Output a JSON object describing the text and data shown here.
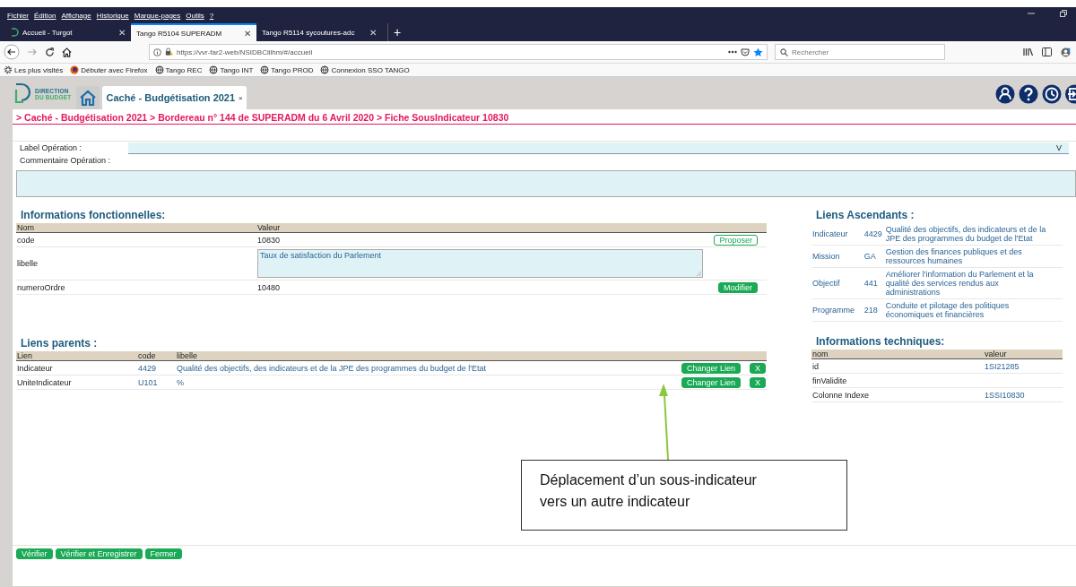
{
  "browser": {
    "menu": [
      "Fichier",
      "Édition",
      "Affichage",
      "Historique",
      "Marque-pages",
      "Outils",
      "?"
    ],
    "tabs": [
      {
        "label": "Accueil - Turgot",
        "selected": false,
        "close": "✕"
      },
      {
        "label": "Tango R5104 SUPERADM",
        "selected": true,
        "close": "✕"
      },
      {
        "label": "Tango R5114 sycoutures-adc",
        "selected": false,
        "close": "✕"
      }
    ],
    "new_tab": "+",
    "url": "https://vvr-far2-web/NSIDBClilhm/#/accueil",
    "search_placeholder": "Rechercher",
    "bookmarks": [
      {
        "label": "Les plus visités",
        "kind": "gear"
      },
      {
        "label": "Débuter avec Firefox",
        "kind": "firefox"
      },
      {
        "label": "Tango REC",
        "kind": "globe"
      },
      {
        "label": "Tango INT",
        "kind": "globe"
      },
      {
        "label": "Tango PROD",
        "kind": "globe"
      },
      {
        "label": "Connexion SSO TANGO",
        "kind": "globe"
      }
    ]
  },
  "app": {
    "logo_lines": [
      "DIRECTION",
      "DU BUDGET"
    ],
    "tab_label": "Caché - Budgétisation 2021",
    "tab_close": "×",
    "breadcrumb": "> Caché - Budgétisation 2021 > Bordereau n° 144 de SUPERADM du 6 Avril 2020 > Fiche SousIndicateur 10830",
    "label_operation": {
      "label": "Label Opération :",
      "arrow": "V"
    },
    "commentaire": {
      "label": "Commentaire Opération :"
    }
  },
  "infos_fonctionnelles": {
    "title": "Informations fonctionnelles:",
    "columns": [
      "Nom",
      "Valeur"
    ],
    "rows": [
      {
        "name": "code",
        "value": "10830",
        "kind": "text",
        "button": {
          "label": "Proposer",
          "kind": "outline"
        }
      },
      {
        "name": "libelle",
        "value": "Taux de satisfaction du Parlement",
        "kind": "textarea"
      },
      {
        "name": "numeroOrdre",
        "value": "10480",
        "kind": "text",
        "button": {
          "label": "Modifier",
          "kind": "filled"
        }
      }
    ]
  },
  "liens_parents": {
    "title": "Liens parents :",
    "columns": [
      "Lien",
      "code",
      "libelle"
    ],
    "rows": [
      {
        "lien": "Indicateur",
        "code": "4429",
        "libelle": "Qualité des objectifs, des indicateurs et de la JPE des programmes du budget de l'Etat",
        "change_button": "Changer Lien",
        "delete_button": "X"
      },
      {
        "lien": "UniteIndicateur",
        "code": "U101",
        "libelle": "%",
        "change_button": "Changer Lien",
        "delete_button": "X"
      }
    ]
  },
  "liens_ascendants": {
    "title": "Liens Ascendants :",
    "rows": [
      {
        "type": "Indicateur",
        "code": "4429",
        "libelle": "Qualité des objectifs, des indicateurs et de la JPE des programmes du budget de l'Etat"
      },
      {
        "type": "Mission",
        "code": "GA",
        "libelle": "Gestion des finances publiques et des ressources humaines"
      },
      {
        "type": "Objectif",
        "code": "441",
        "libelle": "Améliorer l'information du Parlement et la qualité des services rendus aux administrations"
      },
      {
        "type": "Programme",
        "code": "218",
        "libelle": "Conduite et pilotage des politiques économiques et financières"
      }
    ]
  },
  "infos_techniques": {
    "title": "Informations techniques:",
    "columns": [
      "nom",
      "valeur"
    ],
    "rows": [
      {
        "nom": "id",
        "valeur": "1SI21285"
      },
      {
        "nom": "finValidite"
      },
      {
        "nom": "Colonne Indexe",
        "valeur": "1SSI10830"
      }
    ]
  },
  "footer_buttons": [
    "Vérifier",
    "Vérifier et Enregistrer",
    "Fermer"
  ],
  "callout": {
    "text": "Déplacement d’un sous-indicateur vers un autre indicateur"
  }
}
